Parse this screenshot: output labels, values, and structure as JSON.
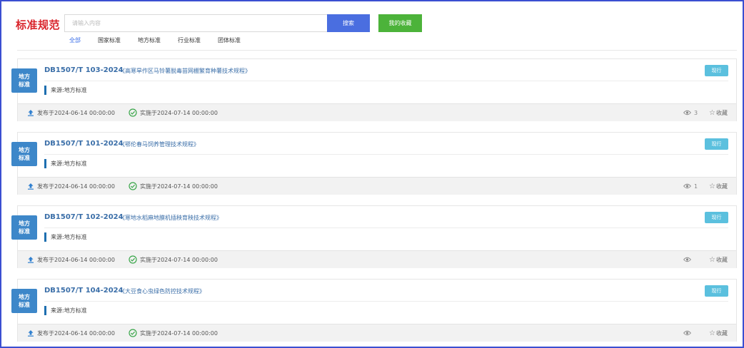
{
  "header": {
    "logo": "标准规范",
    "search_placeholder": "请输入内容",
    "search_label": "搜索",
    "favorites_label": "我的收藏"
  },
  "filters": [
    "全部",
    "国家标准",
    "地方标准",
    "行业标准",
    "团体标准"
  ],
  "active_filter": "全部",
  "items": [
    {
      "badge": [
        "地方",
        "标准"
      ],
      "code": "DB1507/T 103-2024",
      "title": "《高寒旱作区马铃薯脱毒苗网棚繁育种薯技术规程》",
      "status": "现行",
      "source": "来源:地方标准",
      "published": "发布于2024-06-14 00:00:00",
      "implemented": "实施于2024-07-14 00:00:00",
      "views": "3",
      "collect": "收藏"
    },
    {
      "badge": [
        "地方",
        "标准"
      ],
      "code": "DB1507/T 101-2024",
      "title": "《鄂伦春马饲养管理技术规程》",
      "status": "现行",
      "source": "来源:地方标准",
      "published": "发布于2024-06-14 00:00:00",
      "implemented": "实施于2024-07-14 00:00:00",
      "views": "1",
      "collect": "收藏"
    },
    {
      "badge": [
        "地方",
        "标准"
      ],
      "code": "DB1507/T 102-2024",
      "title": "《寒地水稻麻地膜机插秧育秧技术规程》",
      "status": "现行",
      "source": "来源:地方标准",
      "published": "发布于2024-06-14 00:00:00",
      "implemented": "实施于2024-07-14 00:00:00",
      "views": "",
      "collect": "收藏"
    },
    {
      "badge": [
        "地方",
        "标准"
      ],
      "code": "DB1507/T 104-2024",
      "title": "《大豆食心虫绿色防控技术规程》",
      "status": "现行",
      "source": "来源:地方标准",
      "published": "发布于2024-06-14 00:00:00",
      "implemented": "实施于2024-07-14 00:00:00",
      "views": "",
      "collect": "收藏"
    }
  ],
  "colors": {
    "logo": "#d9242b",
    "search_button": "#4a6ee0",
    "favorites_button": "#4cb33a",
    "badge": "#3d87c9",
    "status": "#5bc0de",
    "link": "#3a6ea8"
  }
}
